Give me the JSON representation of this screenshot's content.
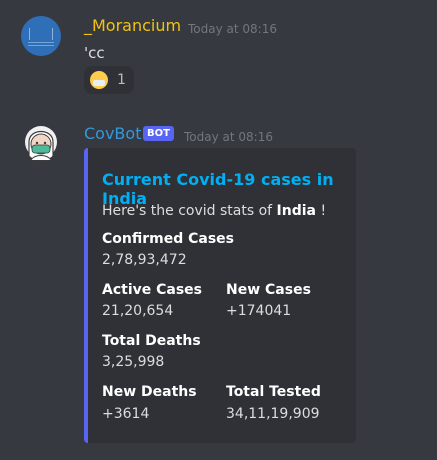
{
  "messages": [
    {
      "username": "_Morancium",
      "timestamp": "Today at 08:16",
      "text": "'cc",
      "reaction": {
        "emoji": "face-with-medical-mask",
        "count": "1"
      }
    },
    {
      "username": "CovBot",
      "badge": "BOT",
      "timestamp": "Today at 08:16",
      "embed": {
        "title": "Current Covid-19 cases in India",
        "description_prefix": "Here's the covid stats of ",
        "description_country": "India",
        "description_suffix": " !",
        "fields": [
          {
            "name": "Confirmed Cases",
            "value": "2,78,93,472"
          },
          {
            "name": "Active Cases",
            "value": "21,20,654"
          },
          {
            "name": "New Cases",
            "value": "+174041"
          },
          {
            "name": "Total Deaths",
            "value": "3,25,998"
          },
          {
            "name": "New Deaths",
            "value": "+3614"
          },
          {
            "name": "Total Tested",
            "value": "34,11,19,909"
          }
        ]
      }
    }
  ],
  "colors": {
    "background": "#36393f",
    "username_1": "#f1c40f",
    "username_2": "#3498db",
    "embed_bar": "#5865f2",
    "embed_title": "#00aff4"
  }
}
